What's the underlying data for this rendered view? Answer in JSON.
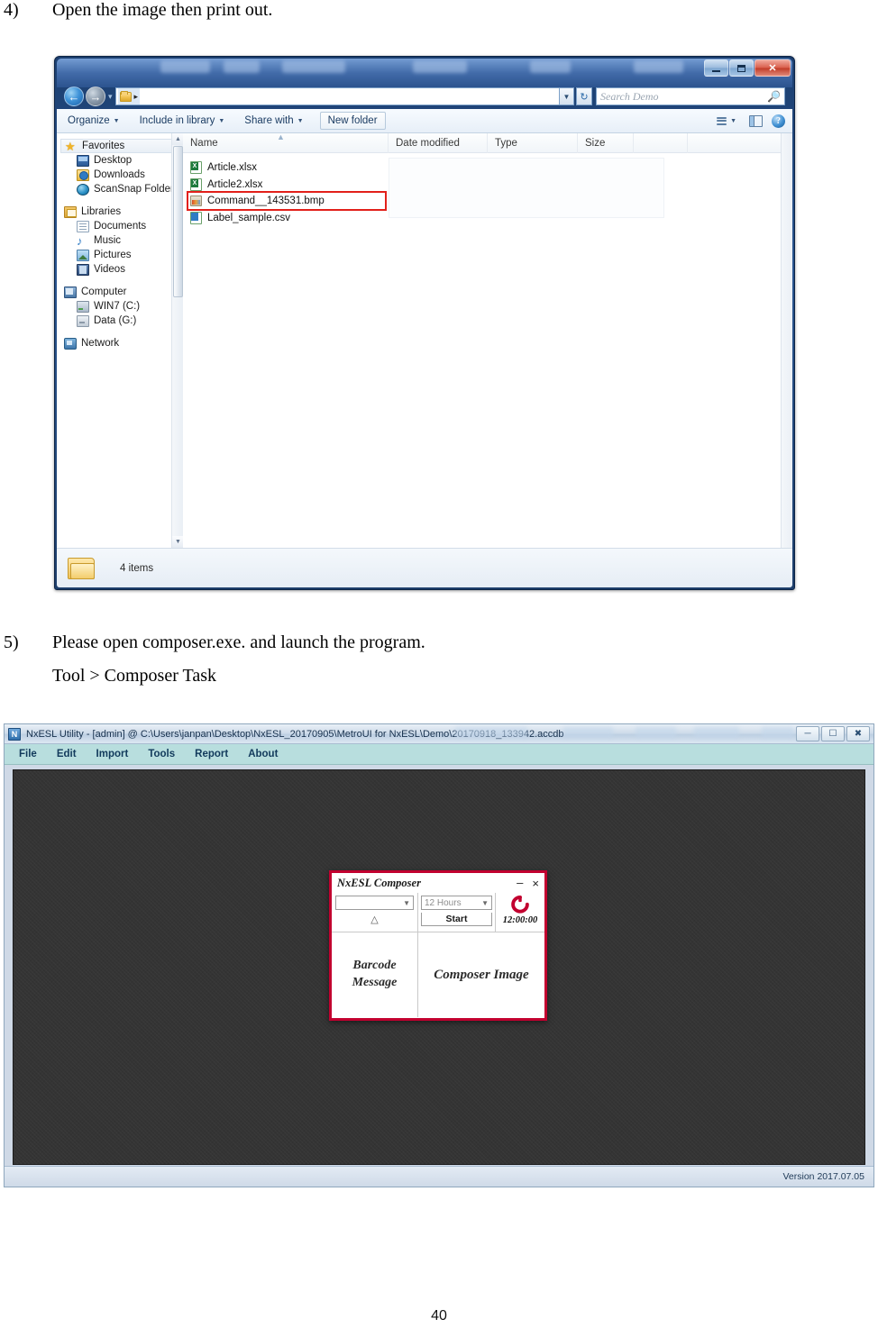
{
  "document": {
    "step4": {
      "number": "4)",
      "text": "Open the image then print out."
    },
    "step5": {
      "number": "5)",
      "line1": "Please open composer.exe. and launch the program.",
      "line2": "Tool > Composer Task"
    },
    "page_number": "40"
  },
  "explorer": {
    "search": {
      "placeholder": "Search Demo"
    },
    "toolbar": {
      "organize": "Organize",
      "include_in_library": "Include in library",
      "share_with": "Share with",
      "new_folder": "New folder"
    },
    "nav_pane": {
      "groups": [
        {
          "root": "Favorites",
          "icon": "star-icon",
          "selected": true,
          "children": [
            {
              "label": "Desktop",
              "icon": "desktop-icon"
            },
            {
              "label": "Downloads",
              "icon": "downloads-icon"
            },
            {
              "label": "ScanSnap Folder",
              "icon": "scansnap-icon"
            }
          ]
        },
        {
          "root": "Libraries",
          "icon": "libraries-icon",
          "selected": false,
          "children": [
            {
              "label": "Documents",
              "icon": "document-icon"
            },
            {
              "label": "Music",
              "icon": "music-icon"
            },
            {
              "label": "Pictures",
              "icon": "pictures-icon"
            },
            {
              "label": "Videos",
              "icon": "videos-icon"
            }
          ]
        },
        {
          "root": "Computer",
          "icon": "computer-icon",
          "selected": false,
          "children": [
            {
              "label": "WIN7 (C:)",
              "icon": "hard-drive-icon"
            },
            {
              "label": "Data (G:)",
              "icon": "drive-icon"
            }
          ]
        },
        {
          "root": "Network",
          "icon": "network-icon",
          "selected": false,
          "children": []
        }
      ]
    },
    "columns": [
      "Name",
      "Date modified",
      "Type",
      "Size"
    ],
    "files": [
      {
        "name": "Article.xlsx",
        "icon": "excel-file-icon",
        "highlighted": false
      },
      {
        "name": "Article2.xlsx",
        "icon": "excel-file-icon",
        "highlighted": false
      },
      {
        "name": "Command__143531.bmp",
        "icon": "bitmap-file-icon",
        "highlighted": true
      },
      {
        "name": "Label_sample.csv",
        "icon": "csv-file-icon",
        "highlighted": false
      }
    ],
    "status": {
      "item_count": "4 items"
    },
    "colors": {
      "highlight": "#e2201a",
      "titlebar": "#1c3f70"
    }
  },
  "nxesl": {
    "title": "NxESL Utility - [admin] @ C:\\Users\\janpan\\Desktop\\NxESL_20170905\\MetroUI for NxESL\\Demo\\20170918_133942.accdb",
    "menu": [
      "File",
      "Edit",
      "Import",
      "Tools",
      "Report",
      "About"
    ],
    "version": "Version 2017.07.05",
    "colors": {
      "menu_bg": "#b8dede",
      "canvas": "#343434"
    }
  },
  "composer": {
    "title": "NxESL Composer",
    "minimize_label": "–",
    "close_label": "×",
    "source_select": {
      "value": "",
      "placeholder": ""
    },
    "warning_glyph": "△",
    "duration_select": {
      "value": "12 Hours"
    },
    "start_button": "Start",
    "refresh_icon": "refresh-icon",
    "time": "12:00:00",
    "barcode_panel": {
      "line1": "Barcode",
      "line2": "Message"
    },
    "image_panel": "Composer Image",
    "colors": {
      "border": "#c2002f",
      "accent": "#c2002f"
    }
  }
}
